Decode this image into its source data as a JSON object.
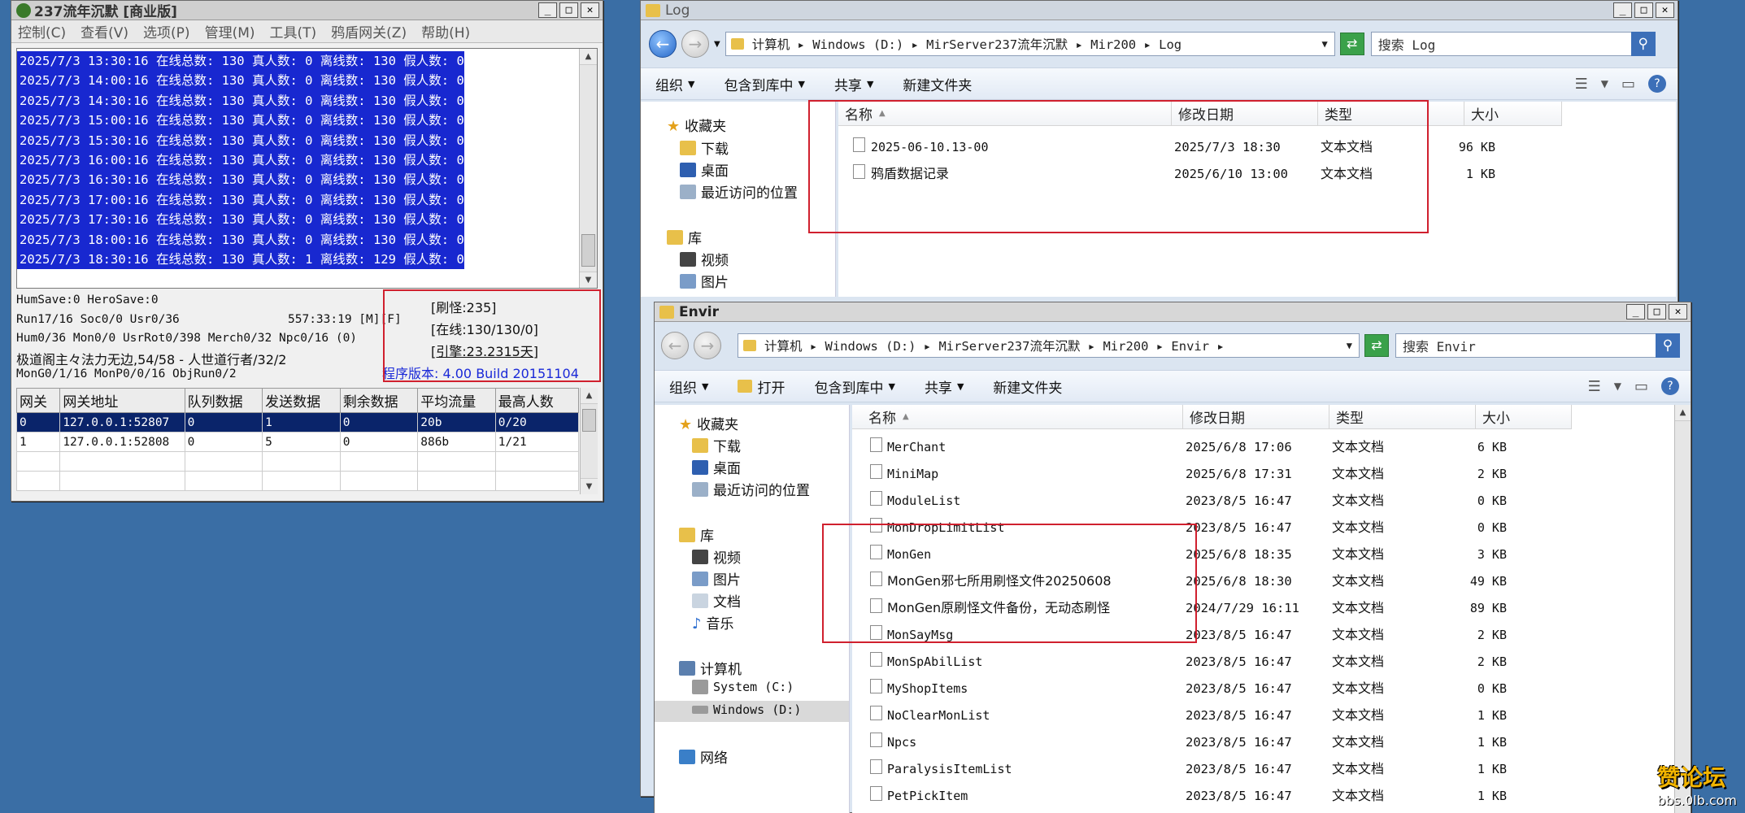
{
  "mir": {
    "title": "237流年沉默 [商业版]",
    "menu": [
      "控制(C)",
      "查看(V)",
      "选项(P)",
      "管理(M)",
      "工具(T)",
      "鸦盾网关(Z)",
      "帮助(H)"
    ],
    "log_lines": [
      "2025/7/3 13:30:16 在线总数: 130 真人数: 0 离线数: 130 假人数: 0",
      "2025/7/3 14:00:16 在线总数: 130 真人数: 0 离线数: 130 假人数: 0",
      "2025/7/3 14:30:16 在线总数: 130 真人数: 0 离线数: 130 假人数: 0",
      "2025/7/3 15:00:16 在线总数: 130 真人数: 0 离线数: 130 假人数: 0",
      "2025/7/3 15:30:16 在线总数: 130 真人数: 0 离线数: 130 假人数: 0",
      "2025/7/3 16:00:16 在线总数: 130 真人数: 0 离线数: 130 假人数: 0",
      "2025/7/3 16:30:16 在线总数: 130 真人数: 0 离线数: 130 假人数: 0",
      "2025/7/3 17:00:16 在线总数: 130 真人数: 0 离线数: 130 假人数: 0",
      "2025/7/3 17:30:16 在线总数: 130 真人数: 0 离线数: 130 假人数: 0",
      "2025/7/3 18:00:16 在线总数: 130 真人数: 0 离线数: 130 假人数: 0",
      "2025/7/3 18:30:16 在线总数: 130 真人数: 1 离线数: 129 假人数: 0"
    ],
    "status1": "HumSave:0 HeroSave:0",
    "status2": "Run17/16 Soc0/0 Usr0/36",
    "status2b": "557:33:19 [M][F]",
    "status3": "Hum0/36 Mon0/0 UsrRot0/398 Merch0/32 Npc0/16 (0)",
    "status4": "极道阁主々法力无边,54/58 - 人世道行者/32/2",
    "status5": "MonG0/1/16 MonP0/0/16 ObjRun0/2",
    "refresh_monsters": "[刷怪:235]",
    "online": "[在线:130/130/0]",
    "engine": "[引擎:23.2315天]",
    "version": "程序版本: 4.00 Build 20151104",
    "gw_headers": [
      "网关",
      "网关地址",
      "队列数据",
      "发送数据",
      "剩余数据",
      "平均流量",
      "最高人数"
    ],
    "gw_rows": [
      [
        "0",
        "127.0.0.1:52807",
        "0",
        "1",
        "0",
        "20b",
        "0/20"
      ],
      [
        "1",
        "127.0.0.1:52808",
        "0",
        "5",
        "0",
        "886b",
        "1/21"
      ]
    ]
  },
  "log_win": {
    "title": "Log",
    "path": "计算机 ▸ Windows (D:) ▸ MirServer237流年沉默 ▸ Mir200 ▸ Log",
    "search": "搜索 Log",
    "toolbar": [
      "组织",
      "包含到库中",
      "共享",
      "新建文件夹"
    ],
    "tree": [
      "收藏夹",
      "下载",
      "桌面",
      "最近访问的位置",
      "库",
      "视频",
      "图片"
    ],
    "cols": [
      "名称",
      "修改日期",
      "类型",
      "大小"
    ],
    "files": [
      {
        "name": "2025-06-10.13-00",
        "date": "2025/7/3 18:30",
        "type": "文本文档",
        "size": "96 KB"
      },
      {
        "name": "鸦盾数据记录",
        "date": "2025/6/10 13:00",
        "type": "文本文档",
        "size": "1 KB"
      }
    ]
  },
  "envir_win": {
    "title": "Envir",
    "path": "计算机 ▸ Windows (D:) ▸ MirServer237流年沉默 ▸ Mir200 ▸ Envir ▸",
    "search": "搜索 Envir",
    "toolbar": [
      "组织",
      "打开",
      "包含到库中",
      "共享",
      "新建文件夹"
    ],
    "tree": [
      "收藏夹",
      "下载",
      "桌面",
      "最近访问的位置",
      "库",
      "视频",
      "图片",
      "文档",
      "音乐",
      "计算机",
      "System (C:)",
      "Windows (D:)",
      "网络"
    ],
    "cols": [
      "名称",
      "修改日期",
      "类型",
      "大小"
    ],
    "files": [
      {
        "name": "MerChant",
        "date": "2025/6/8 17:06",
        "type": "文本文档",
        "size": "6 KB"
      },
      {
        "name": "MiniMap",
        "date": "2025/6/8 17:31",
        "type": "文本文档",
        "size": "2 KB"
      },
      {
        "name": "ModuleList",
        "date": "2023/8/5 16:47",
        "type": "文本文档",
        "size": "0 KB"
      },
      {
        "name": "MonDropLimitList",
        "date": "2023/8/5 16:47",
        "type": "文本文档",
        "size": "0 KB"
      },
      {
        "name": "MonGen",
        "date": "2025/6/8 18:35",
        "type": "文本文档",
        "size": "3 KB"
      },
      {
        "name": "MonGen邪七所用刷怪文件20250608",
        "date": "2025/6/8 18:30",
        "type": "文本文档",
        "size": "49 KB"
      },
      {
        "name": "MonGen原刷怪文件备份，无动态刷怪",
        "date": "2024/7/29 16:11",
        "type": "文本文档",
        "size": "89 KB"
      },
      {
        "name": "MonSayMsg",
        "date": "2023/8/5 16:47",
        "type": "文本文档",
        "size": "2 KB"
      },
      {
        "name": "MonSpAbilList",
        "date": "2023/8/5 16:47",
        "type": "文本文档",
        "size": "2 KB"
      },
      {
        "name": "MyShopItems",
        "date": "2023/8/5 16:47",
        "type": "文本文档",
        "size": "0 KB"
      },
      {
        "name": "NoClearMonList",
        "date": "2023/8/5 16:47",
        "type": "文本文档",
        "size": "1 KB"
      },
      {
        "name": "Npcs",
        "date": "2023/8/5 16:47",
        "type": "文本文档",
        "size": "1 KB"
      },
      {
        "name": "ParalysisItemList",
        "date": "2023/8/5 16:47",
        "type": "文本文档",
        "size": "1 KB"
      },
      {
        "name": "PetPickItem",
        "date": "2023/8/5 16:47",
        "type": "文本文档",
        "size": "1 KB"
      }
    ]
  },
  "watermark": {
    "line1": "赞论坛",
    "line2": "bbs.0lb.com"
  }
}
